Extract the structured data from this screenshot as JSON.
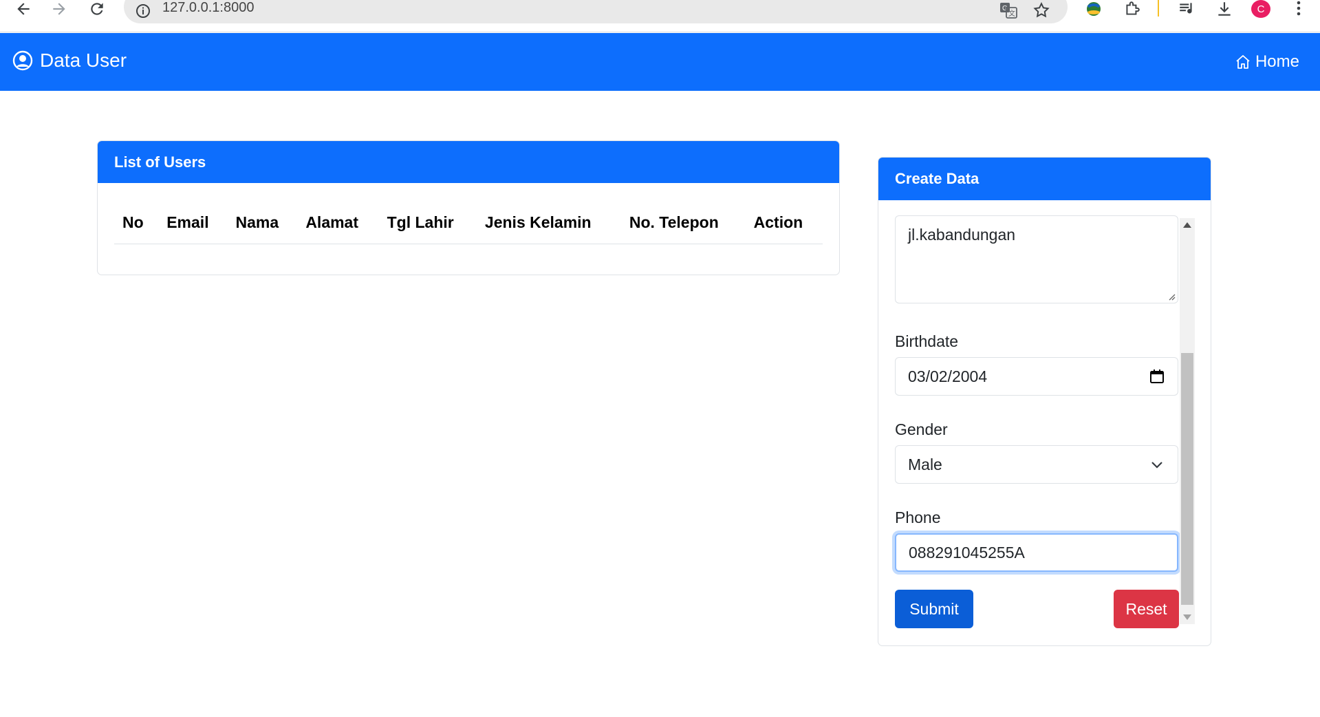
{
  "browser": {
    "url": "127.0.0.1:8000",
    "profile_initial": "C",
    "icons": {
      "back": "arrow-left-icon",
      "forward": "arrow-right-icon",
      "reload": "reload-icon",
      "site_info": "info-icon",
      "translate": "translate-icon",
      "bookmark": "star-icon",
      "extension_app": "globe-extension-icon",
      "extensions": "puzzle-icon",
      "media": "media-controls-icon",
      "download": "download-icon",
      "menu": "kebab-menu-icon"
    }
  },
  "navbar": {
    "brand": "Data User",
    "home": "Home",
    "color": "#0d6efd"
  },
  "users_card": {
    "title": "List of Users",
    "columns": [
      "No",
      "Email",
      "Nama",
      "Alamat",
      "Tgl Lahir",
      "Jenis Kelamin",
      "No. Telepon",
      "Action"
    ],
    "rows": []
  },
  "create_card": {
    "title": "Create Data",
    "address_value": "jl.kabandungan",
    "birthdate_label": "Birthdate",
    "birthdate_value": "03/02/2004",
    "gender_label": "Gender",
    "gender_value": "Male",
    "phone_label": "Phone",
    "phone_value": "088291045255A",
    "submit_label": "Submit",
    "reset_label": "Reset",
    "submit_color": "#0b5ed7",
    "reset_color": "#dc3545"
  }
}
